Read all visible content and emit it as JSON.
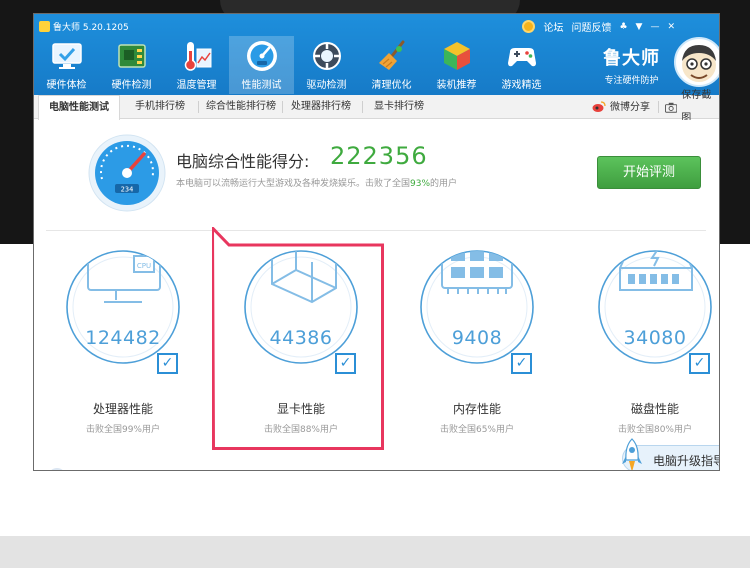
{
  "app": {
    "title": "鲁大师 5.20.1205",
    "links": [
      "论坛",
      "问题反馈"
    ],
    "window_controls": [
      "♣",
      "▼",
      "—",
      "✕"
    ],
    "brand_name": "鲁大师",
    "brand_slogan": "专注硬件防护"
  },
  "toolbar": [
    {
      "label": "硬件体检",
      "icon": "monitor-check-icon"
    },
    {
      "label": "硬件检测",
      "icon": "circuit-board-icon"
    },
    {
      "label": "温度管理",
      "icon": "thermometer-icon"
    },
    {
      "label": "性能测试",
      "icon": "speedometer-icon",
      "active": true
    },
    {
      "label": "驱动检测",
      "icon": "driver-gear-icon"
    },
    {
      "label": "清理优化",
      "icon": "broom-icon"
    },
    {
      "label": "装机推荐",
      "icon": "cube-icon"
    },
    {
      "label": "游戏精选",
      "icon": "gamepad-icon"
    }
  ],
  "tabs": [
    "电脑性能测试",
    "手机排行榜",
    "综合性能排行榜",
    "处理器排行榜",
    "显卡排行榜"
  ],
  "share": {
    "weibo": "微博分享",
    "screenshot": "保存截图"
  },
  "score": {
    "title": "电脑综合性能得分:",
    "value": "222356",
    "desc_prefix": "本电脑可以流畅运行大型游戏及各种发烧娱乐。击败了全国",
    "desc_pct": "93%",
    "desc_suffix": "的用户",
    "gauge_text": "234"
  },
  "start_button": "开始评测",
  "cards": [
    {
      "name": "处理器性能",
      "value": "124482",
      "desc": "击败全国99%用户",
      "icon": "cpu-monitor-icon",
      "chip_label": "CPU"
    },
    {
      "name": "显卡性能",
      "value": "44386",
      "desc": "击败全国88%用户",
      "icon": "graphics-cube-icon"
    },
    {
      "name": "内存性能",
      "value": "9408",
      "desc": "击败全国65%用户",
      "icon": "memory-chip-icon"
    },
    {
      "name": "磁盘性能",
      "value": "34080",
      "desc": "击败全国80%用户",
      "icon": "hard-disk-icon"
    }
  ],
  "upgrade_guide": "电脑升级指导",
  "colors": {
    "accent_blue": "#1a84d4",
    "score_green": "#3faa3f",
    "highlight_red": "#e8365e",
    "value_blue": "#4d9fd8"
  }
}
